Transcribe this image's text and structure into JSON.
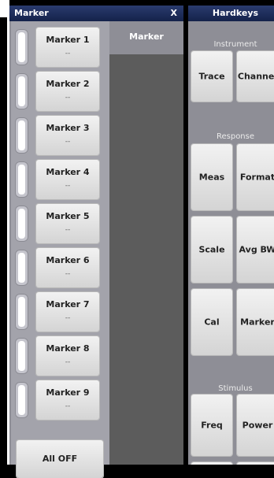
{
  "marker_panel": {
    "title": "Marker",
    "close_label": "X",
    "detail_title": "Marker",
    "markers": [
      {
        "label": "Marker 1",
        "value": "--"
      },
      {
        "label": "Marker 2",
        "value": "--"
      },
      {
        "label": "Marker 3",
        "value": "--"
      },
      {
        "label": "Marker 4",
        "value": "--"
      },
      {
        "label": "Marker 5",
        "value": "--"
      },
      {
        "label": "Marker 6",
        "value": "--"
      },
      {
        "label": "Marker 7",
        "value": "--"
      },
      {
        "label": "Marker 8",
        "value": "--"
      },
      {
        "label": "Marker 9",
        "value": "--"
      }
    ],
    "all_off_label": "All OFF"
  },
  "hardkeys": {
    "title": "Hardkeys",
    "groups": {
      "instrument": "Instrument",
      "response": "Response",
      "stimulus": "Stimulus"
    },
    "buttons": {
      "trace": "Trace",
      "channel": "Channel",
      "meas": "Meas",
      "format": "Format",
      "scale": "Scale",
      "avg_bw": "Avg BW",
      "cal": "Cal",
      "marker": "Marker",
      "freq": "Freq",
      "power": "Power"
    }
  }
}
